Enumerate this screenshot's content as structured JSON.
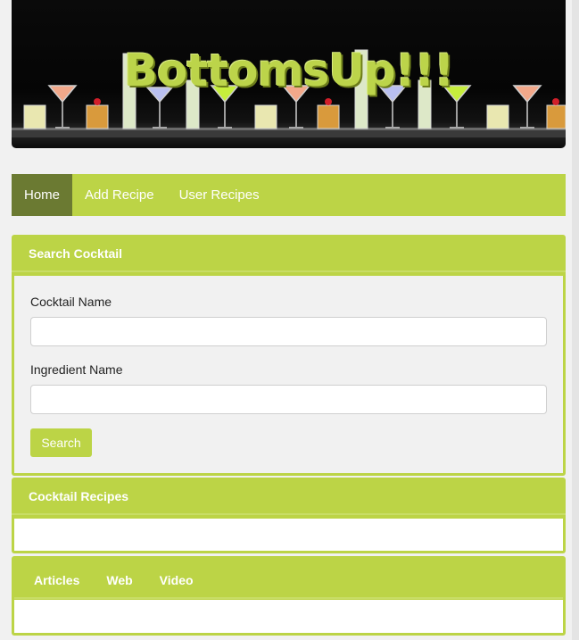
{
  "banner": {
    "logo_text": "BottomsUp!!!"
  },
  "nav": {
    "items": [
      {
        "label": "Home",
        "active": true
      },
      {
        "label": "Add Recipe",
        "active": false
      },
      {
        "label": "User Recipes",
        "active": false
      }
    ]
  },
  "search_panel": {
    "title": "Search Cocktail",
    "cocktail_label": "Cocktail Name",
    "cocktail_value": "",
    "ingredient_label": "Ingredient Name",
    "ingredient_value": "",
    "button_label": "Search"
  },
  "recipes_panel": {
    "title": "Cocktail Recipes"
  },
  "media_panel": {
    "tabs": [
      {
        "label": "Articles"
      },
      {
        "label": "Web"
      },
      {
        "label": "Video"
      }
    ]
  },
  "colors": {
    "accent": "#bcd446",
    "nav_active": "#6b7a32",
    "background": "#f1f1f1"
  }
}
